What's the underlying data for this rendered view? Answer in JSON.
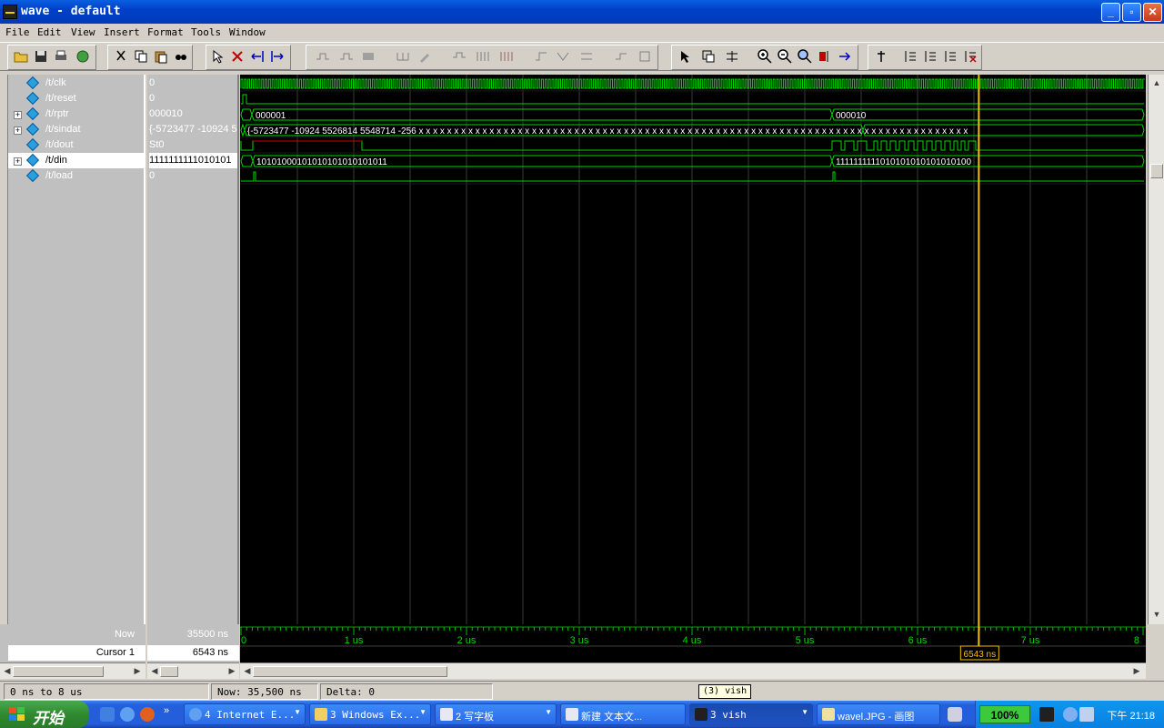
{
  "window": {
    "title": "wave - default"
  },
  "menu": [
    "File",
    "Edit",
    "View",
    "Insert",
    "Format",
    "Tools",
    "Window"
  ],
  "signals": [
    {
      "name": "/t/clk",
      "value": "0",
      "expandable": false
    },
    {
      "name": "/t/reset",
      "value": "0",
      "expandable": false
    },
    {
      "name": "/t/rptr",
      "value": "000010",
      "expandable": true
    },
    {
      "name": "/t/sindat",
      "value": "{-5723477 -10924 55",
      "expandable": true
    },
    {
      "name": "/t/dout",
      "value": "St0",
      "expandable": false
    },
    {
      "name": "/t/din",
      "value": "1111111111010101",
      "expandable": true,
      "selected": true
    },
    {
      "name": "/t/load",
      "value": "0",
      "expandable": false
    }
  ],
  "wave_labels": {
    "rptr_a": "000001",
    "rptr_b": "000010",
    "sindat": "{-5723477 -10924 5526814 5548714 -256 x x x x x x x x x x x x x x x x x x x x x x x x x x x x x x x x x x x x x x x x x x x x x x x x x x x x x x x x x x x x x x x x x x x x x x x x x x x x x x",
    "din_a": "10101000101010101010101011",
    "din_b": "1111111111010101010101010100"
  },
  "timeline": {
    "now_label": "Now",
    "now_value": "35500 ns",
    "cursor_label": "Cursor 1",
    "cursor_value": "6543 ns",
    "cursor_tag": "6543 ns",
    "ticks": [
      {
        "t_us": 0,
        "label": "0"
      },
      {
        "t_us": 1,
        "label": "1 us"
      },
      {
        "t_us": 2,
        "label": "2 us"
      },
      {
        "t_us": 3,
        "label": "3 us"
      },
      {
        "t_us": 4,
        "label": "4 us"
      },
      {
        "t_us": 5,
        "label": "5 us"
      },
      {
        "t_us": 6,
        "label": "6 us"
      },
      {
        "t_us": 7,
        "label": "7 us"
      },
      {
        "t_us": 8,
        "label": "8"
      }
    ],
    "cursor_us": 6.543
  },
  "status": {
    "range": "0 ns to 8 us",
    "now": "Now: 35,500 ns",
    "delta": "Delta: 0"
  },
  "tooltip": "(3) vish",
  "taskbar": {
    "start": "开始",
    "tasks": [
      "4 Internet E...",
      "3 Windows Ex...",
      "2 写字板",
      "新建 文本文...",
      "3 vish",
      "wavel.JPG - 画图"
    ],
    "zoom": "100%",
    "clock": "下午 21:18"
  },
  "colors": {
    "wave_green": "#00d800",
    "cursor_yellow": "#f0c000",
    "grid": "#3a3a3a"
  }
}
